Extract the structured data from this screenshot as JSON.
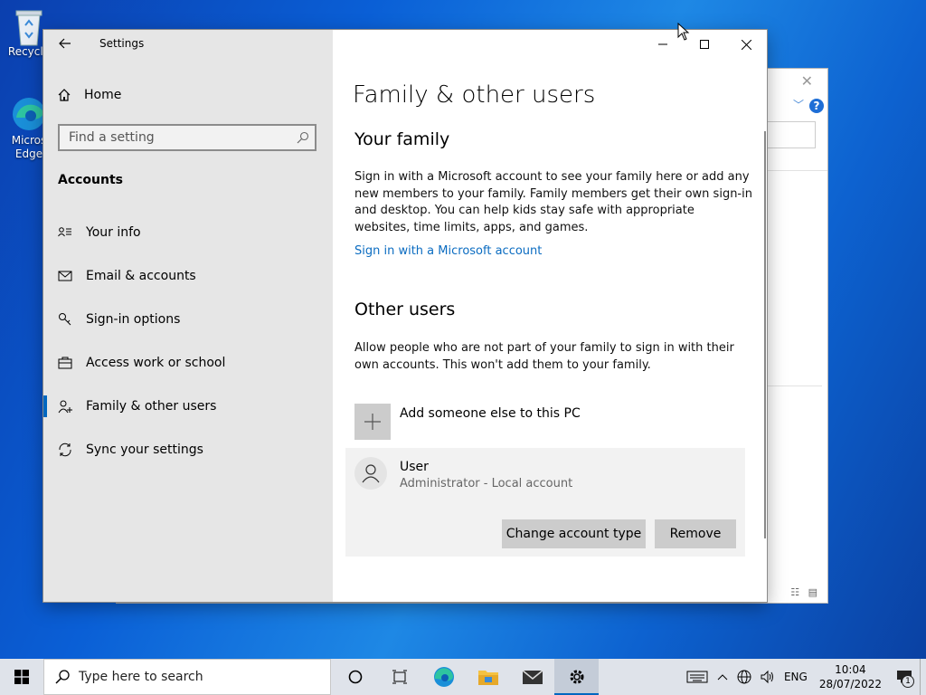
{
  "desktop": {
    "icons": [
      {
        "label": "Recycle"
      },
      {
        "label": "Micros",
        "label2": "Edge"
      }
    ]
  },
  "window": {
    "title": "Settings",
    "sidebar": {
      "home": "Home",
      "search_placeholder": "Find a setting",
      "section": "Accounts",
      "items": [
        {
          "label": "Your info",
          "icon": "person-list-icon",
          "active": false
        },
        {
          "label": "Email & accounts",
          "icon": "mail-icon",
          "active": false
        },
        {
          "label": "Sign-in options",
          "icon": "key-icon",
          "active": false
        },
        {
          "label": "Access work or school",
          "icon": "briefcase-icon",
          "active": false
        },
        {
          "label": "Family & other users",
          "icon": "person-add-icon",
          "active": true
        },
        {
          "label": "Sync your settings",
          "icon": "sync-icon",
          "active": false
        }
      ]
    },
    "main": {
      "title": "Family & other users",
      "family": {
        "heading": "Your family",
        "description": "Sign in with a Microsoft account to see your family here or add any new members to your family. Family members get their own sign-in and desktop. You can help kids stay safe with appropriate websites, time limits, apps, and games.",
        "link": "Sign in with a Microsoft account"
      },
      "other": {
        "heading": "Other users",
        "description": "Allow people who are not part of your family to sign in with their own accounts. This won't add them to your family.",
        "add_label": "Add someone else to this PC",
        "user": {
          "name": "User",
          "role": "Administrator - Local account",
          "change_button": "Change account type",
          "remove_button": "Remove"
        }
      }
    }
  },
  "taskbar": {
    "search_placeholder": "Type here to search",
    "language": "ENG",
    "time": "10:04",
    "date": "28/07/2022",
    "notification_count": "1"
  },
  "colors": {
    "accent": "#0067c0",
    "link": "#0b6cc1",
    "sidebar_bg": "#e6e6e6"
  }
}
